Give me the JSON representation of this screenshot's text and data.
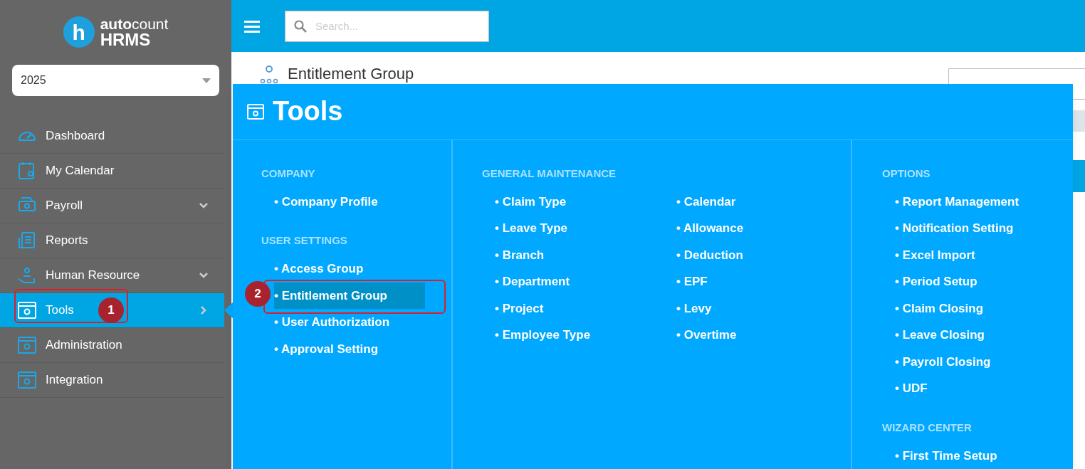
{
  "logo": {
    "brand": "**auto**count",
    "mark": "h",
    "product": "HRMS"
  },
  "year_select": {
    "value": "2025"
  },
  "nav": [
    {
      "label": "Dashboard",
      "selected": false
    },
    {
      "label": "My Calendar",
      "selected": false
    },
    {
      "label": "Payroll",
      "selected": false,
      "kind": "dropdown"
    },
    {
      "label": "Reports",
      "selected": false
    },
    {
      "label": "Human Resource",
      "selected": false,
      "kind": "dropdown"
    },
    {
      "label": "Tools",
      "selected": true,
      "kind": "flyout",
      "callout": "1"
    },
    {
      "label": "Administration",
      "selected": false
    },
    {
      "label": "Integration",
      "selected": false
    }
  ],
  "search": {
    "placeholder": "Search..."
  },
  "page": {
    "title": "Entitlement Group"
  },
  "menu": {
    "title": "Tools",
    "columns": [
      {
        "sections": [
          {
            "heading": "COMPANY",
            "items": [
              {
                "label": "• Company Profile",
                "selected": false
              }
            ]
          },
          {
            "heading": "USER SETTINGS",
            "items": [
              {
                "label": "• Access Group",
                "selected": false
              },
              {
                "label": "• Entitlement Group",
                "selected": true,
                "callout": "2"
              },
              {
                "label": "• User Authorization",
                "selected": false
              },
              {
                "label": "• Approval Setting",
                "selected": false
              }
            ]
          }
        ]
      },
      {
        "sections": [
          {
            "heading": "GENERAL MAINTENANCE",
            "items": [
              {
                "label": "• Claim Type",
                "selected": false
              },
              {
                "label": "• Leave Type",
                "selected": false
              },
              {
                "label": "• Branch",
                "selected": false
              },
              {
                "label": "• Department",
                "selected": false
              },
              {
                "label": "• Project",
                "selected": false
              },
              {
                "label": "• Employee Type",
                "selected": false
              },
              {
                "label": "• Calendar",
                "selected": false
              },
              {
                "label": "• Allowance",
                "selected": false
              },
              {
                "label": "• Deduction",
                "selected": false
              },
              {
                "label": "• EPF",
                "selected": false
              },
              {
                "label": "• Levy",
                "selected": false
              },
              {
                "label": "• Overtime",
                "selected": false
              }
            ]
          }
        ]
      },
      {
        "sections": [
          {
            "heading": "OPTIONS",
            "items": [
              {
                "label": "• Report Management",
                "selected": false
              },
              {
                "label": "• Notification Setting",
                "selected": false
              },
              {
                "label": "• Excel Import",
                "selected": false
              },
              {
                "label": "• Period Setup",
                "selected": false
              },
              {
                "label": "• Claim Closing",
                "selected": false
              },
              {
                "label": "• Leave Closing",
                "selected": false
              },
              {
                "label": "• Payroll Closing",
                "selected": false
              },
              {
                "label": "• UDF",
                "selected": false
              }
            ]
          },
          {
            "heading": "WIZARD CENTER",
            "items": [
              {
                "label": "• First Time Setup",
                "selected": false
              }
            ]
          }
        ]
      }
    ]
  }
}
